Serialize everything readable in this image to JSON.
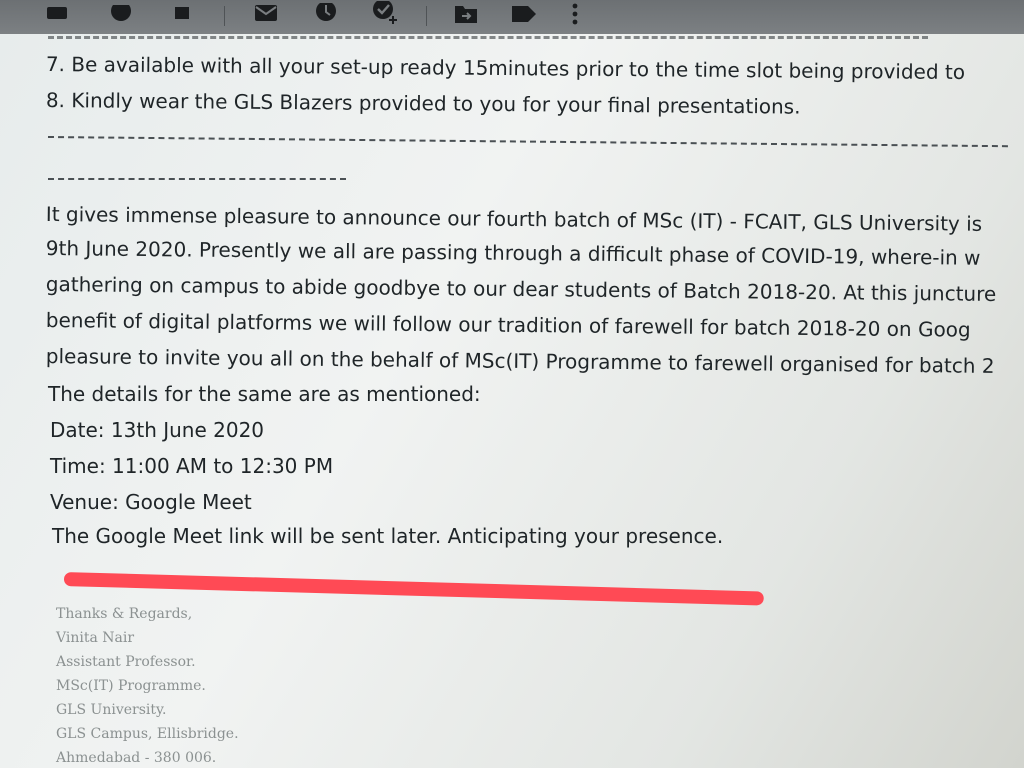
{
  "toolbar": {
    "icons": [
      "archive-icon",
      "report-spam-icon",
      "delete-icon",
      "mail-icon",
      "snooze-icon",
      "add-task-icon",
      "move-to-icon",
      "label-icon",
      "more-options-icon"
    ]
  },
  "email": {
    "instructions": [
      "7. Be available with all your set-up ready 15minutes prior to the time slot being provided to",
      "8. Kindly wear the GLS Blazers provided to you for your final presentations."
    ],
    "body": [
      "It gives immense pleasure to announce our fourth batch of MSc (IT) - FCAIT,  GLS University is",
      "9th June 2020. Presently we all are passing through a difficult phase of COVID-19, where-in w",
      "gathering on campus to abide goodbye to our dear students of Batch 2018-20. At this juncture",
      "benefit of digital platforms we will follow our tradition of farewell for batch 2018-20 on Goog",
      "pleasure to invite you all on the behalf of MSc(IT) Programme to farewell organised for batch 2",
      "The details for the same are as mentioned:"
    ],
    "details": {
      "date": "Date: 13th June 2020",
      "time": "Time: 11:00 AM to 12:30 PM",
      "venue": "Venue: Google Meet",
      "note": "The Google Meet link will be sent later. Anticipating your presence."
    },
    "signature": [
      "Thanks & Regards,",
      "Vinita Nair",
      "Assistant Professor.",
      "MSc(IT) Programme.",
      "GLS University.",
      "GLS Campus, Ellisbridge.",
      "Ahmedabad - 380 006."
    ]
  },
  "colors": {
    "highlight": "#ff4a55",
    "toolbar": "#72767a"
  }
}
